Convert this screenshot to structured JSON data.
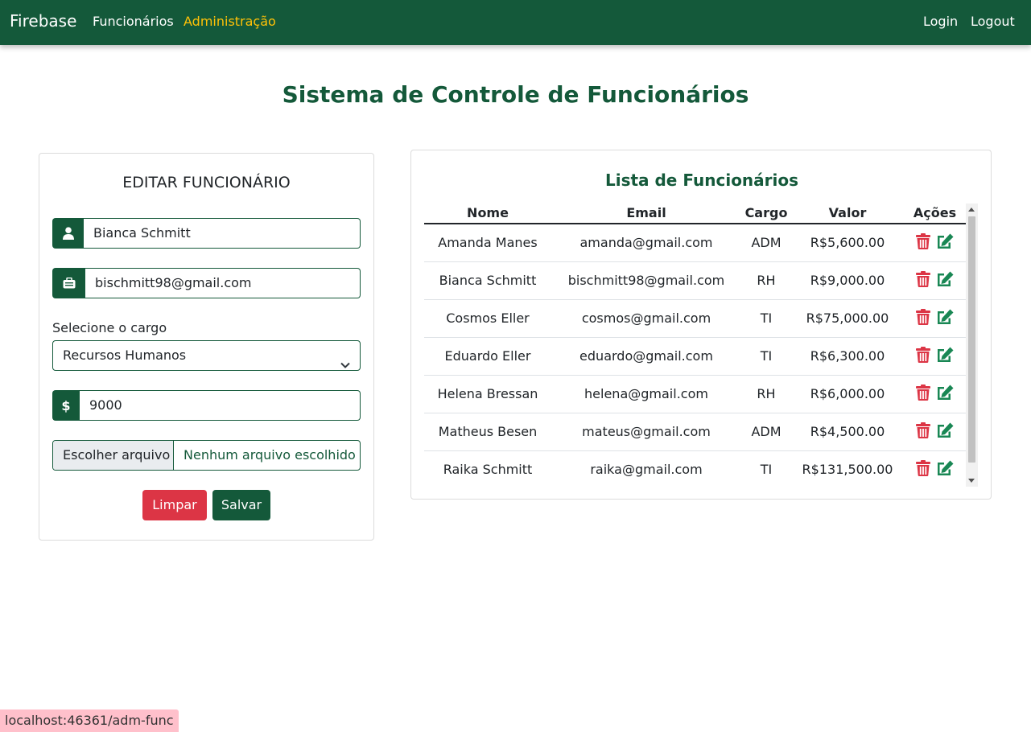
{
  "navbar": {
    "brand": "Firebase",
    "links": [
      "Funcionários",
      "Administração"
    ],
    "right_links": [
      "Login",
      "Logout"
    ],
    "active_color": "#ffc107",
    "bg_color": "#14593a"
  },
  "page_title": "Sistema de Controle de Funcionários",
  "form": {
    "title": "EDITAR FUNCIONÁRIO",
    "name_value": "Bianca Schmitt",
    "email_value": "bischmitt98@gmail.com",
    "select_label": "Selecione o cargo",
    "select_value": "Recursos Humanos",
    "salary_value": "9000",
    "file_button": "Escolher arquivo",
    "file_text": "Nenhum arquivo escolhido",
    "clear_label": "Limpar",
    "save_label": "Salvar",
    "icons": [
      "user-icon",
      "id-badge-icon",
      "dollar-icon"
    ]
  },
  "list": {
    "title": "Lista de Funcionários",
    "columns": [
      "Nome",
      "Email",
      "Cargo",
      "Valor",
      "Ações"
    ],
    "rows": [
      {
        "nome": "Amanda Manes",
        "email": "amanda@gmail.com",
        "cargo": "ADM",
        "valor": "R$5,600.00"
      },
      {
        "nome": "Bianca Schmitt",
        "email": "bischmitt98@gmail.com",
        "cargo": "RH",
        "valor": "R$9,000.00"
      },
      {
        "nome": "Cosmos Eller",
        "email": "cosmos@gmail.com",
        "cargo": "TI",
        "valor": "R$75,000.00"
      },
      {
        "nome": "Eduardo Eller",
        "email": "eduardo@gmail.com",
        "cargo": "TI",
        "valor": "R$6,300.00"
      },
      {
        "nome": "Helena Bressan",
        "email": "helena@gmail.com",
        "cargo": "RH",
        "valor": "R$6,000.00"
      },
      {
        "nome": "Matheus Besen",
        "email": "mateus@gmail.com",
        "cargo": "ADM",
        "valor": "R$4,500.00"
      },
      {
        "nome": "Raika Schmitt",
        "email": "raika@gmail.com",
        "cargo": "TI",
        "valor": "R$131,500.00"
      }
    ],
    "action_icons": [
      "trash-icon",
      "edit-icon"
    ],
    "delete_color": "#dc3545",
    "edit_color": "#198754"
  },
  "status_url": "localhost:46361/adm-func"
}
